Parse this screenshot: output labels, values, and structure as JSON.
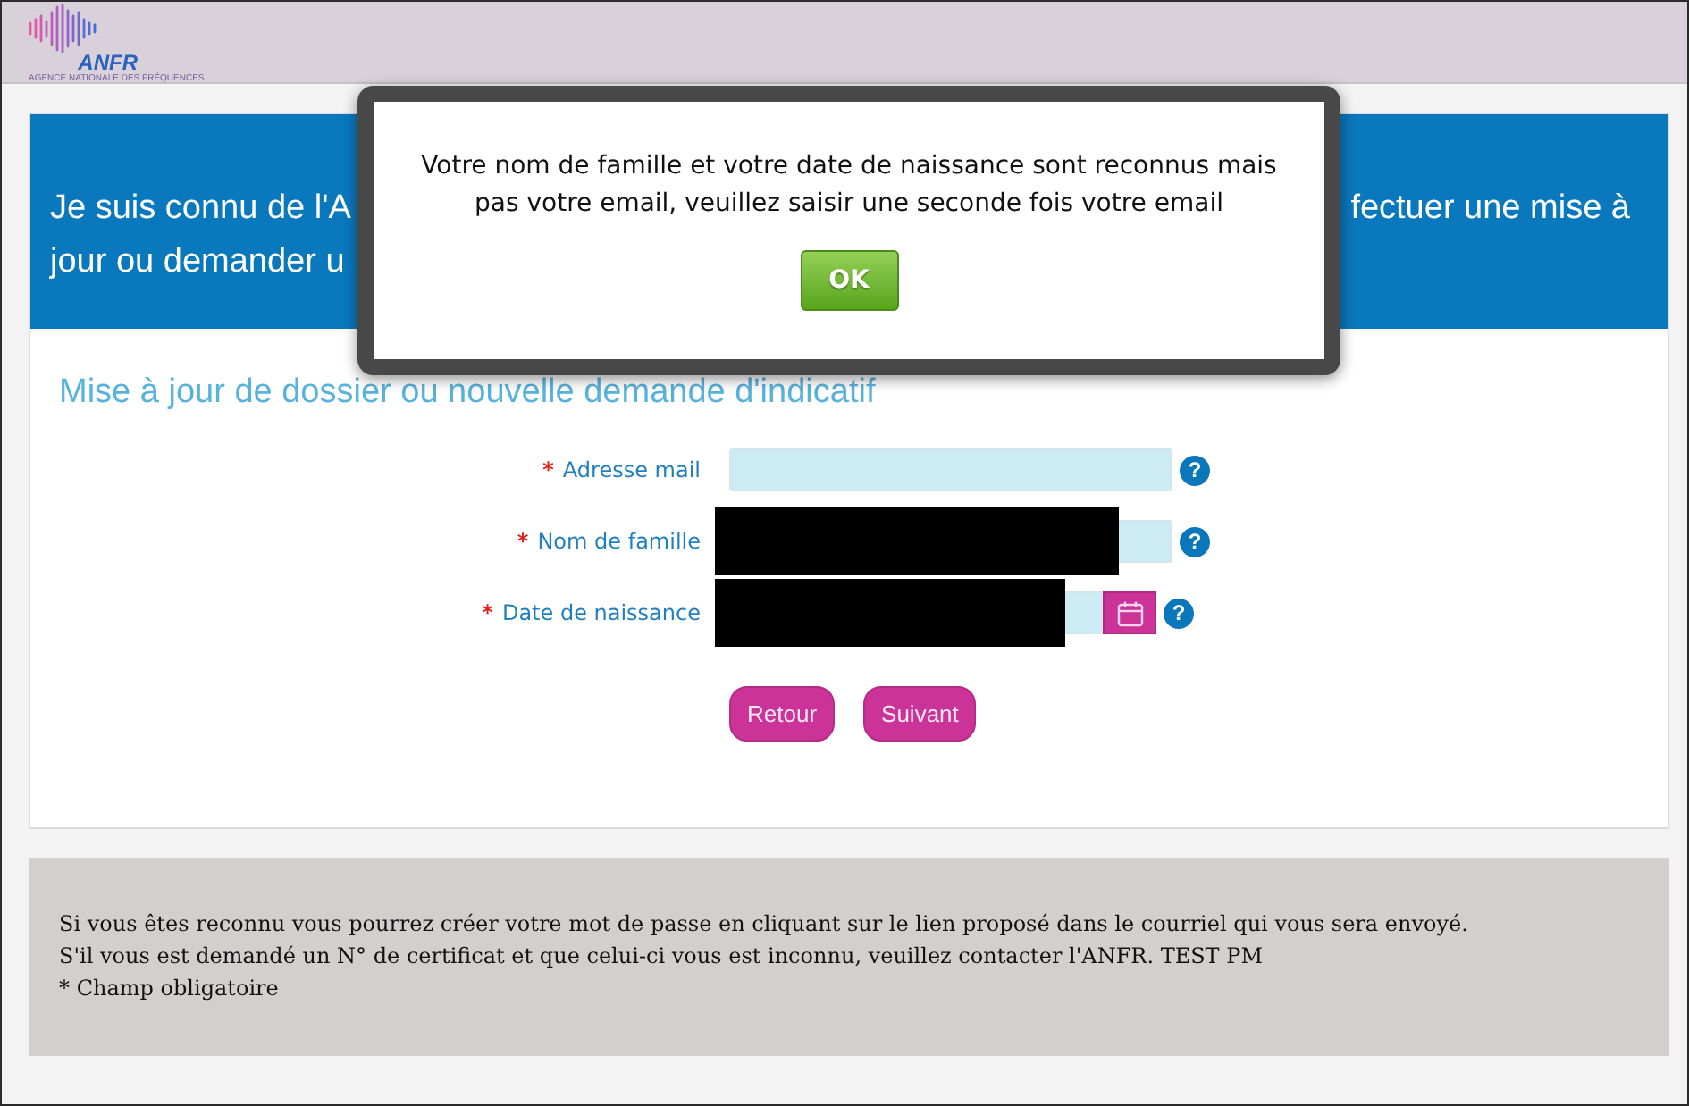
{
  "header": {
    "logo": {
      "wordmark": "ANFR",
      "tagline": "AGENCE NATIONALE DES FRÉQUENCES"
    }
  },
  "banner": {
    "left_lines": [
      "Je suis connu de l'A",
      "jour ou demander u"
    ],
    "right_lines": [
      "fectuer une mise à"
    ]
  },
  "form": {
    "title": "Mise à jour de dossier ou nouvelle demande d'indicatif",
    "fields": [
      {
        "kind": "text",
        "required_mark": "*",
        "label": "Adresse mail",
        "help": "?",
        "redacted": false
      },
      {
        "kind": "text",
        "required_mark": "*",
        "label": "Nom de famille",
        "help": "?",
        "redacted": true
      },
      {
        "kind": "date",
        "required_mark": "*",
        "label": "Date de naissance",
        "help": "?",
        "redacted": true
      }
    ],
    "buttons": [
      "Retour",
      "Suivant"
    ]
  },
  "notice": {
    "lines": [
      "Si vous êtes reconnu vous pourrez créer votre mot de passe en cliquant sur le lien proposé dans le courriel qui vous sera envoyé.",
      "S'il vous est demandé un N° de certificat et que celui-ci vous est inconnu, veuillez contacter l'ANFR. TEST PM",
      "* Champ obligatoire"
    ]
  },
  "dialog": {
    "message": "Votre nom de famille et votre date de naissance sont reconnus mais pas votre email, veuillez saisir une seconde fois votre email",
    "button": "OK"
  }
}
